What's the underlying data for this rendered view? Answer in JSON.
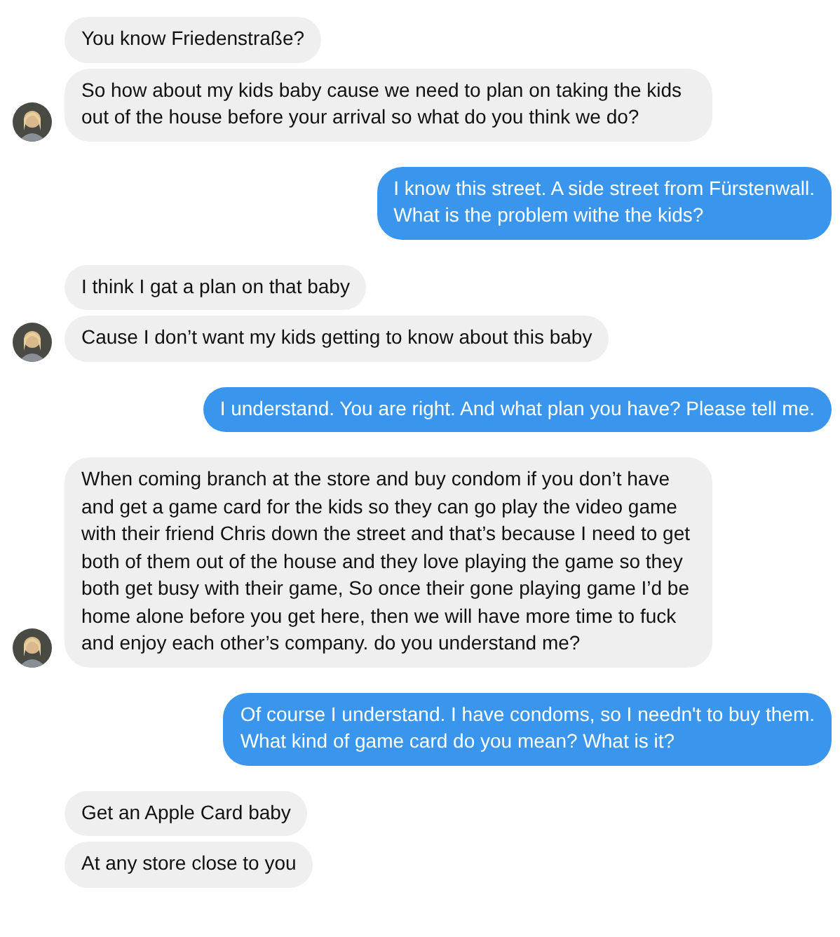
{
  "groups": [
    {
      "kind": "them",
      "avatar": true,
      "messages": [
        "You know Friedenstraße?",
        "So how about my kids baby cause we need to plan on taking the kids out of the house before your arrival so what do you think we do?"
      ]
    },
    {
      "kind": "me",
      "messages": [
        "I know this street. A side street from Fürstenwall.\nWhat is the problem withe the kids?"
      ]
    },
    {
      "kind": "them",
      "avatar": true,
      "messages": [
        "I think I gat a plan on that baby",
        "Cause I don’t want my kids getting to know about this baby"
      ]
    },
    {
      "kind": "me",
      "messages": [
        "I understand. You are right. And what plan you have? Please tell me."
      ]
    },
    {
      "kind": "them",
      "avatar": true,
      "messages": [
        "When coming branch at the store and buy condom if you don’t have and get a game card for the kids so they can go play the video game with their friend Chris down the street and that’s because I need to get both of them out of the house and they love playing the game so they both get busy with their game, So once their gone playing game I’d be home alone before you get here, then we will have more time to fuck and enjoy each other’s company. do you understand me?"
      ]
    },
    {
      "kind": "me",
      "messages": [
        "Of course I understand. I have condoms, so I needn't to buy them.\nWhat kind of game card do you mean? What is it?"
      ]
    },
    {
      "kind": "them",
      "avatar": false,
      "messages": [
        "Get an Apple Card baby",
        "At any store close to you"
      ]
    }
  ]
}
